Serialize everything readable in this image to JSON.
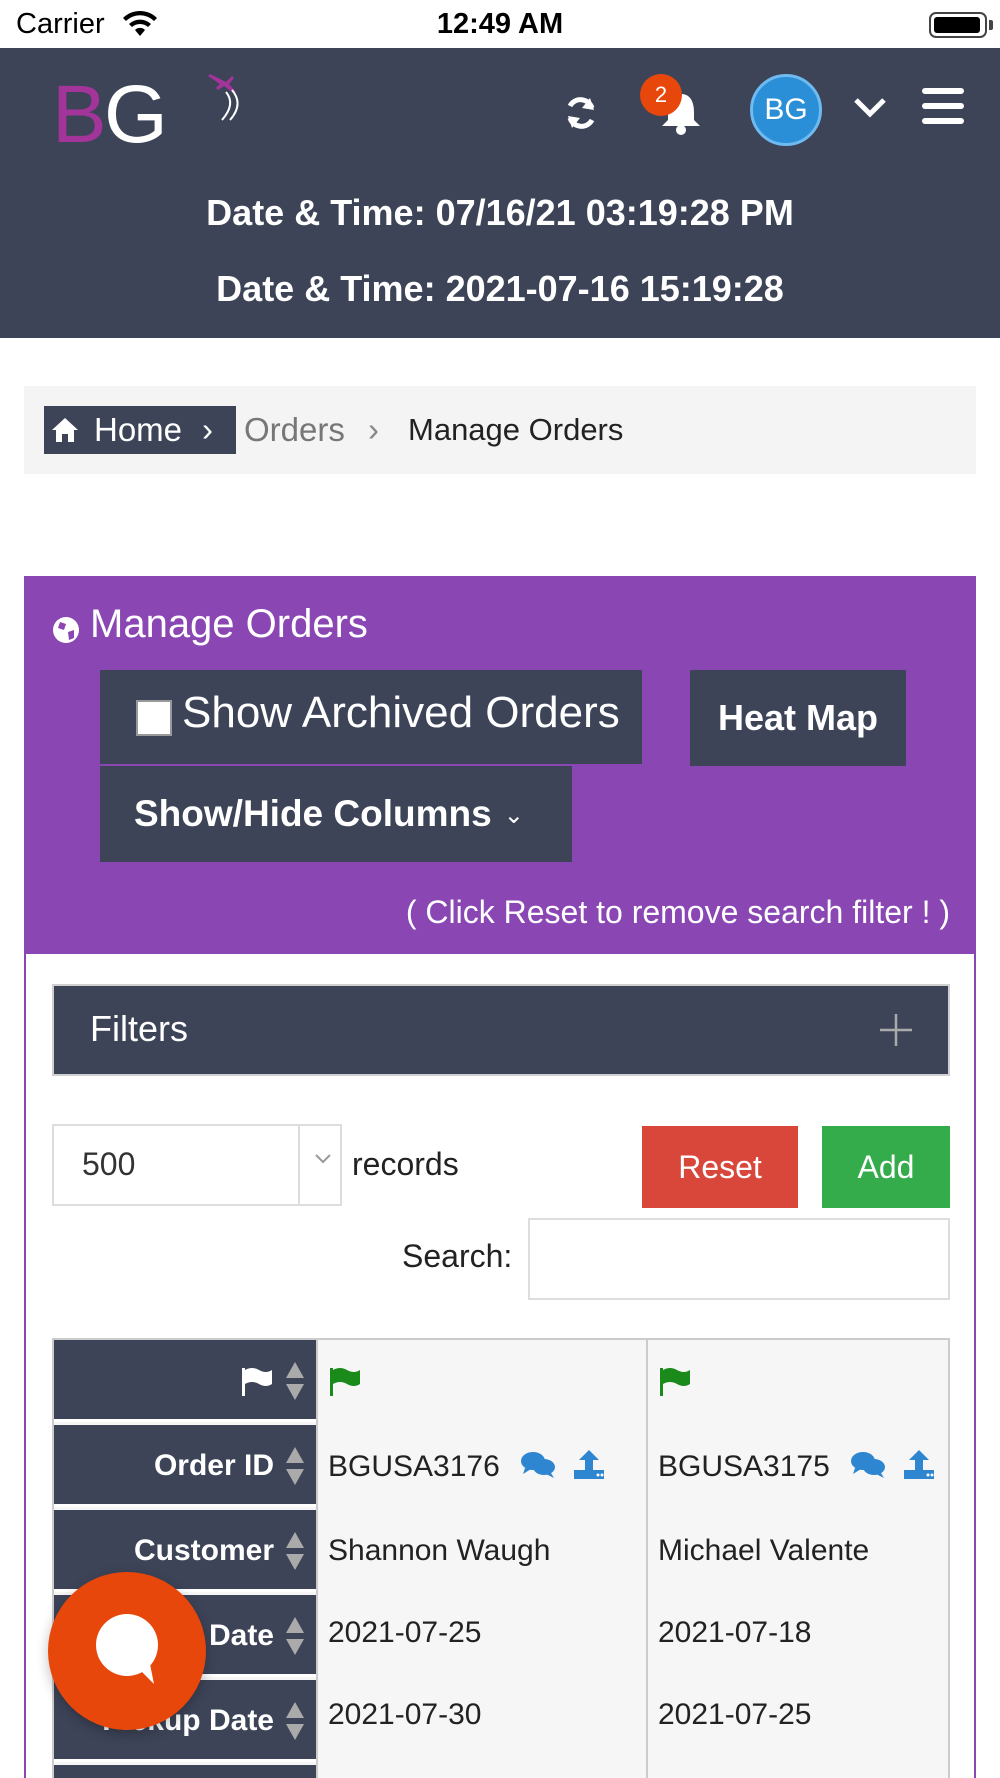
{
  "status_bar": {
    "carrier": "Carrier",
    "time": "12:49 AM"
  },
  "header": {
    "logo_text_b": "B",
    "logo_text_g": "G",
    "notification_count": "2",
    "avatar_initials": "BG",
    "datetime_line_1": "Date & Time: 07/16/21 03:19:28 PM",
    "datetime_line_2": "Date & Time: 2021-07-16 15:19:28"
  },
  "breadcrumb": {
    "home": "Home",
    "separator": "›",
    "orders": "Orders",
    "current": "Manage Orders"
  },
  "panel": {
    "title": "Manage Orders",
    "show_archived_label": "Show Archived Orders",
    "heat_map_label": "Heat Map",
    "show_hide_columns_label": "Show/Hide Columns",
    "reset_hint": "( Click Reset to remove search filter ! )"
  },
  "filters": {
    "label": "Filters"
  },
  "controls": {
    "records_value": "500",
    "records_label": "records",
    "reset_label": "Reset",
    "add_label": "Add",
    "search_label": "Search:",
    "search_value": ""
  },
  "table": {
    "headers": [
      "",
      "Order ID",
      "Customer",
      "Date",
      "Pickup Date"
    ],
    "rows": [
      {
        "order_id": "BGUSA3176",
        "customer": "Shannon Waugh",
        "date": "2021-07-25",
        "pickup_date": "2021-07-30"
      },
      {
        "order_id": "BGUSA3175",
        "customer": "Michael Valente",
        "date": "2021-07-18",
        "pickup_date": "2021-07-25"
      }
    ]
  },
  "colors": {
    "header_bg": "#3d4458",
    "panel_purple": "#8a46b3",
    "logo_magenta": "#a3349a",
    "reset_red": "#d9473a",
    "add_green": "#35ac4c",
    "badge_orange": "#e8470b",
    "flag_green": "#1a8a1a",
    "icon_blue": "#2f86d0"
  },
  "icons": [
    "wifi-icon",
    "battery-icon",
    "refresh-icon",
    "bell-icon",
    "chevron-down-icon",
    "menu-icon",
    "home-icon",
    "globe-icon",
    "plus-icon",
    "sort-icon",
    "flag-icon",
    "chat-icon",
    "upload-icon"
  ]
}
